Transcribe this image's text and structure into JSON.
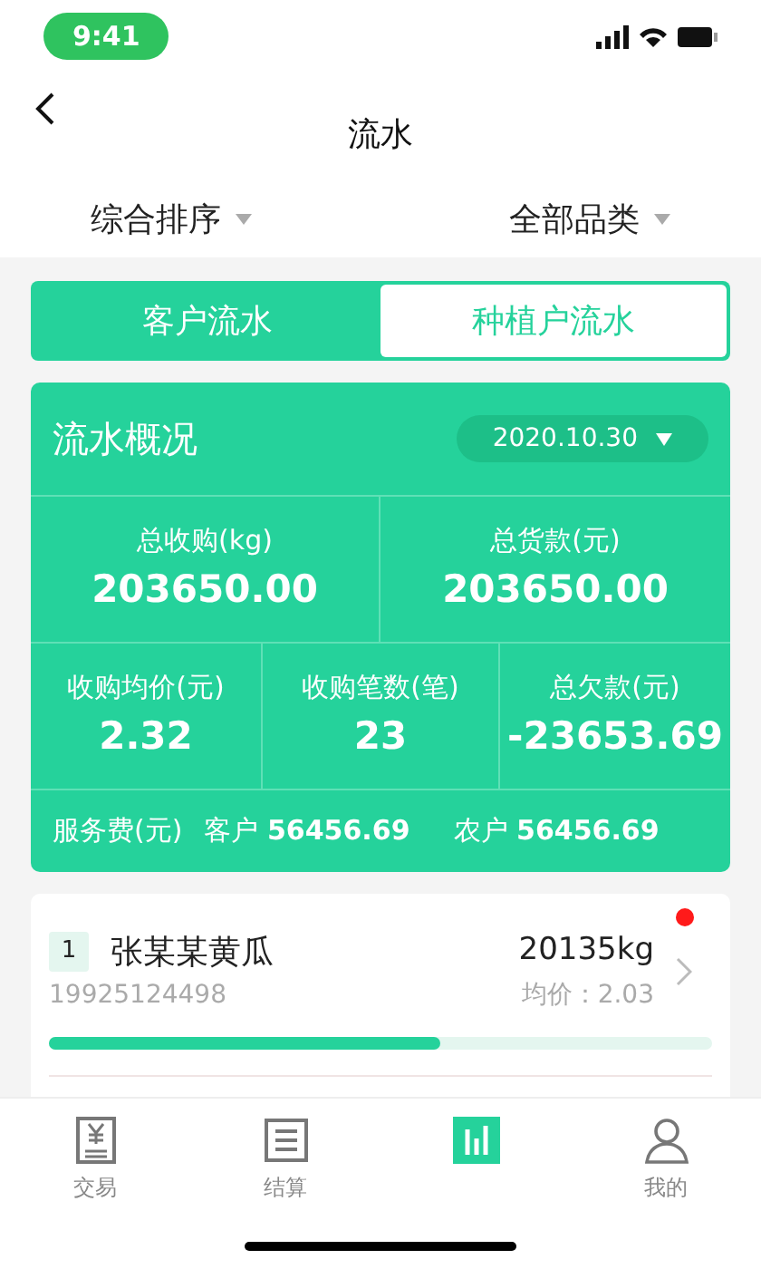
{
  "status_bar": {
    "time": "9:41"
  },
  "nav": {
    "title": "流水"
  },
  "filters": [
    {
      "label": "综合排序"
    },
    {
      "label": "全部品类"
    }
  ],
  "segments": [
    {
      "label": "客户流水",
      "selected": true
    },
    {
      "label": "种植户流水",
      "selected": false
    }
  ],
  "summary": {
    "title": "流水概况",
    "date": "2020.10.30",
    "top": [
      {
        "label": "总收购(kg)",
        "value": "203650.00"
      },
      {
        "label": "总货款(元)",
        "value": "203650.00"
      }
    ],
    "middle": [
      {
        "label": "收购均价(元)",
        "value": "2.32"
      },
      {
        "label": "收购笔数(笔)",
        "value": "23"
      },
      {
        "label": "总欠款(元)",
        "value": "-23653.69"
      }
    ],
    "fee": {
      "label": "服务费(元)",
      "customer_label": "客户",
      "customer_value": "56456.69",
      "farmer_label": "农户",
      "farmer_value": "56456.69"
    }
  },
  "records": [
    {
      "rank": "1",
      "name": "张某某黄瓜",
      "weight": "20135kg",
      "phone": "19925124498",
      "avg_price": "均价：2.03",
      "unread": true,
      "level": 0.59
    }
  ],
  "tab_bar": [
    {
      "kind": "trade",
      "label": "交易",
      "selected": false
    },
    {
      "kind": "settle",
      "label": "结算",
      "selected": false
    },
    {
      "kind": "flow",
      "selected": true
    },
    {
      "kind": "mine",
      "label": "我的",
      "selected": false
    }
  ]
}
